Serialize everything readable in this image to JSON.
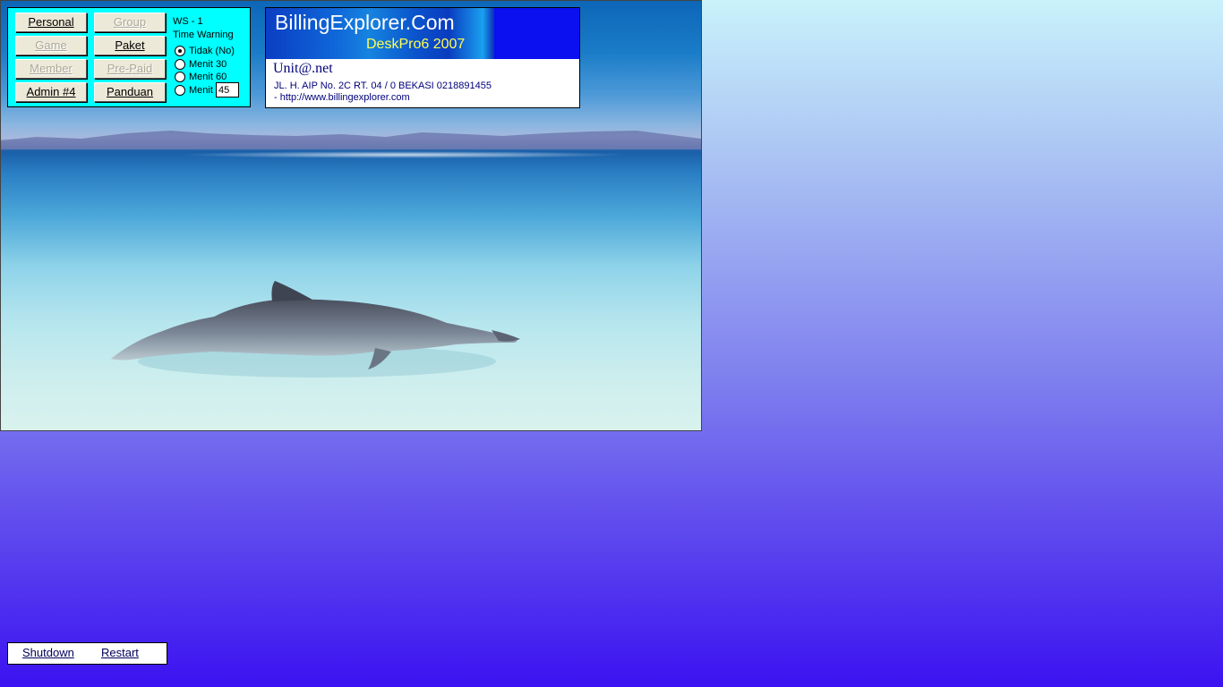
{
  "menu": {
    "buttons": [
      {
        "label": "Personal",
        "enabled": true
      },
      {
        "label": "Group",
        "enabled": false
      },
      {
        "label": "Game",
        "enabled": false
      },
      {
        "label": "Paket",
        "enabled": true
      },
      {
        "label": "Member",
        "enabled": false
      },
      {
        "label": "Pre-Paid",
        "enabled": false
      },
      {
        "label": "Admin #4",
        "enabled": true
      },
      {
        "label": "Panduan",
        "enabled": true
      }
    ],
    "workstation": "WS - 1",
    "time_warning_label": "Time Warning",
    "options": [
      {
        "label": "Tidak (No)",
        "checked": true
      },
      {
        "label": "Menit  30",
        "checked": false
      },
      {
        "label": "Menit  60",
        "checked": false
      },
      {
        "label": "Menit",
        "checked": false
      }
    ],
    "custom_minutes": "45"
  },
  "info": {
    "banner_title": "BillingExplorer.Com",
    "banner_subtitle": "DeskPro6 2007",
    "company": "Unit@.net",
    "address": "JL. H. AIP No. 2C RT. 04 / 0 BEKASI 0218891455",
    "website": "- http://www.billingexplorer.com"
  },
  "bottom": {
    "shutdown_label": "Shutdown",
    "restart_label": "Restart"
  },
  "colors": {
    "menu_panel_bg": "#00ffff",
    "banner_bg": "#0a10f0",
    "banner_subtitle": "#ffff50",
    "company_text": "#00007a"
  }
}
